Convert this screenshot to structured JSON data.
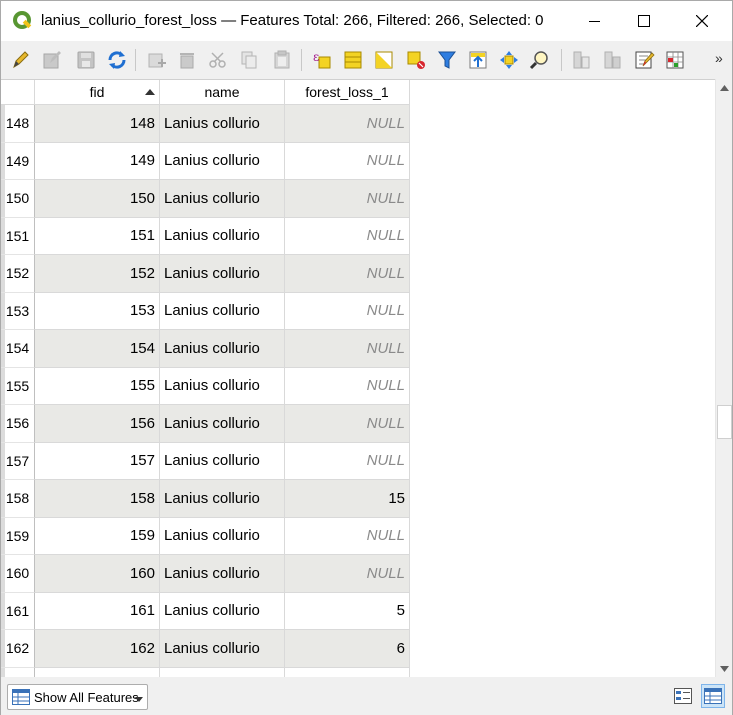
{
  "window": {
    "title": "lanius_collurio_forest_loss — Features Total: 266, Filtered: 266, Selected: 0"
  },
  "toolbar": {
    "icons": [
      "toggle-editing-icon",
      "toggle-multi-edit-icon",
      "save-edits-icon",
      "reload-icon",
      "add-feature-icon",
      "delete-selected-icon",
      "cut-icon",
      "copy-icon",
      "paste-icon",
      "select-by-expression-icon",
      "select-all-icon",
      "invert-selection-icon",
      "deselect-all-icon",
      "filter-select-icon",
      "move-selection-top-icon",
      "pan-map-to-selection-icon",
      "zoom-map-to-selection-icon",
      "new-field-icon",
      "delete-field-icon",
      "open-field-calculator-icon",
      "conditional-formatting-icon"
    ],
    "more_label": "»"
  },
  "table": {
    "columns": [
      {
        "label": "fid",
        "sorted": "ascending"
      },
      {
        "label": "name"
      },
      {
        "label": "forest_loss_1"
      }
    ],
    "rows": [
      {
        "row_no": "148",
        "fid": "148",
        "name": "Lanius collurio",
        "forest_loss_1": "NULL"
      },
      {
        "row_no": "149",
        "fid": "149",
        "name": "Lanius collurio",
        "forest_loss_1": "NULL"
      },
      {
        "row_no": "150",
        "fid": "150",
        "name": "Lanius collurio",
        "forest_loss_1": "NULL"
      },
      {
        "row_no": "151",
        "fid": "151",
        "name": "Lanius collurio",
        "forest_loss_1": "NULL"
      },
      {
        "row_no": "152",
        "fid": "152",
        "name": "Lanius collurio",
        "forest_loss_1": "NULL"
      },
      {
        "row_no": "153",
        "fid": "153",
        "name": "Lanius collurio",
        "forest_loss_1": "NULL"
      },
      {
        "row_no": "154",
        "fid": "154",
        "name": "Lanius collurio",
        "forest_loss_1": "NULL"
      },
      {
        "row_no": "155",
        "fid": "155",
        "name": "Lanius collurio",
        "forest_loss_1": "NULL"
      },
      {
        "row_no": "156",
        "fid": "156",
        "name": "Lanius collurio",
        "forest_loss_1": "NULL"
      },
      {
        "row_no": "157",
        "fid": "157",
        "name": "Lanius collurio",
        "forest_loss_1": "NULL"
      },
      {
        "row_no": "158",
        "fid": "158",
        "name": "Lanius collurio",
        "forest_loss_1": "15"
      },
      {
        "row_no": "159",
        "fid": "159",
        "name": "Lanius collurio",
        "forest_loss_1": "NULL"
      },
      {
        "row_no": "160",
        "fid": "160",
        "name": "Lanius collurio",
        "forest_loss_1": "NULL"
      },
      {
        "row_no": "161",
        "fid": "161",
        "name": "Lanius collurio",
        "forest_loss_1": "5"
      },
      {
        "row_no": "162",
        "fid": "162",
        "name": "Lanius collurio",
        "forest_loss_1": "6"
      }
    ]
  },
  "footer": {
    "filter_button_label": "Show All Features",
    "view_mode": "table"
  },
  "colors": {
    "row_alt": "#e9e9e6",
    "null_text": "#8a8a8a",
    "qgis_green": "#589632"
  }
}
